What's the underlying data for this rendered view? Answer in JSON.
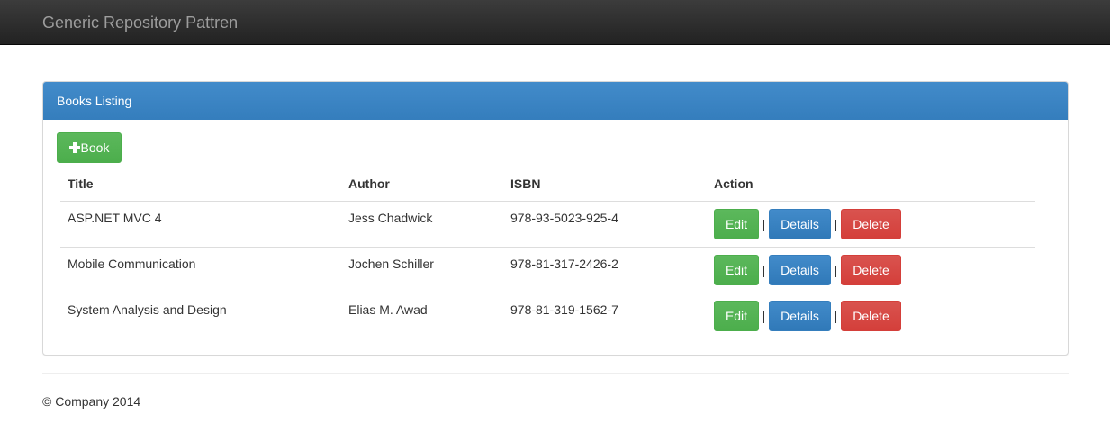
{
  "navbar": {
    "brand": "Generic Repository Pattren"
  },
  "panel": {
    "heading": "Books Listing",
    "add_button_label": "Book"
  },
  "table": {
    "headers": {
      "title": "Title",
      "author": "Author",
      "isbn": "ISBN",
      "action": "Action"
    },
    "rows": [
      {
        "title": "ASP.NET MVC 4",
        "author": "Jess Chadwick",
        "isbn": "978-93-5023-925-4"
      },
      {
        "title": "Mobile Communication",
        "author": "Jochen Schiller",
        "isbn": "978-81-317-2426-2"
      },
      {
        "title": "System Analysis and Design",
        "author": "Elias M. Awad",
        "isbn": "978-81-319-1562-7"
      }
    ],
    "actions": {
      "edit": "Edit",
      "details": "Details",
      "delete": "Delete",
      "separator": "|"
    }
  },
  "footer": {
    "text": "© Company 2014"
  },
  "colors": {
    "navbar": "#222222",
    "panel_heading": "#428bca",
    "success": "#5cb85c",
    "primary": "#428bca",
    "danger": "#d9534f"
  },
  "icons": {
    "add": "plus-icon"
  }
}
